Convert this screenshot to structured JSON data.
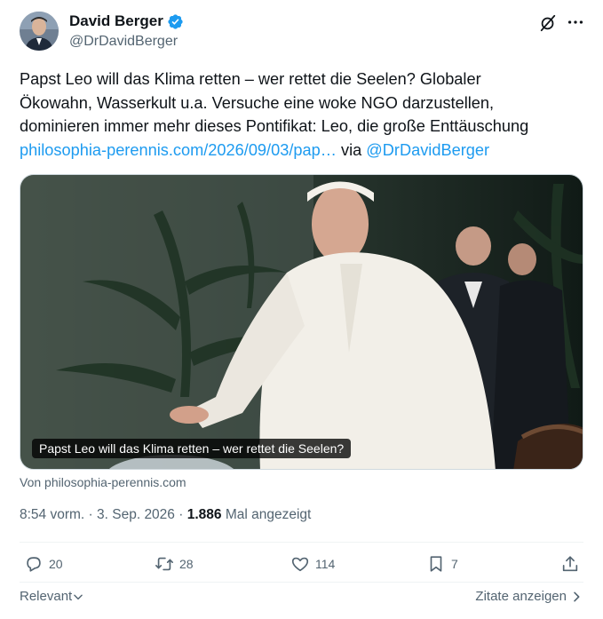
{
  "author": {
    "display_name": "David Berger",
    "handle": "@DrDavidBerger",
    "verified": true
  },
  "post": {
    "text_lines": [
      "Papst Leo will das Klima retten – wer rettet die Seelen? Globaler",
      "Ökowahn, Wasserkult u.a. Versuche eine woke NGO darzustellen,",
      "dominieren immer mehr dieses Pontifikat: Leo, die große Enttäuschung"
    ],
    "link_text": "philosophia-perennis.com/2026/09/03/pap…",
    "via_word": "via",
    "via_handle": "@DrDavidBerger"
  },
  "media": {
    "caption": "Papst Leo will das Klima retten – wer rettet die Seelen?",
    "source": "Von philosophia-perennis.com"
  },
  "meta": {
    "time": "8:54 vorm.",
    "date": "3. Sep. 2026",
    "views_count": "1.886",
    "views_label": "Mal angezeigt"
  },
  "actions": {
    "replies": "20",
    "reposts": "28",
    "likes": "114",
    "bookmarks": "7"
  },
  "footer": {
    "relevant_label": "Relevant",
    "quotes_label": "Zitate anzeigen"
  },
  "colors": {
    "accent": "#1d9bf0",
    "text_primary": "#0f1419",
    "text_secondary": "#536471",
    "divider": "#eff3f4"
  },
  "icons": [
    "verified-badge-icon",
    "grok-icon",
    "more-icon",
    "reply-icon",
    "repost-icon",
    "like-icon",
    "bookmark-icon",
    "share-icon",
    "chevron-down-icon",
    "chevron-right-icon"
  ]
}
